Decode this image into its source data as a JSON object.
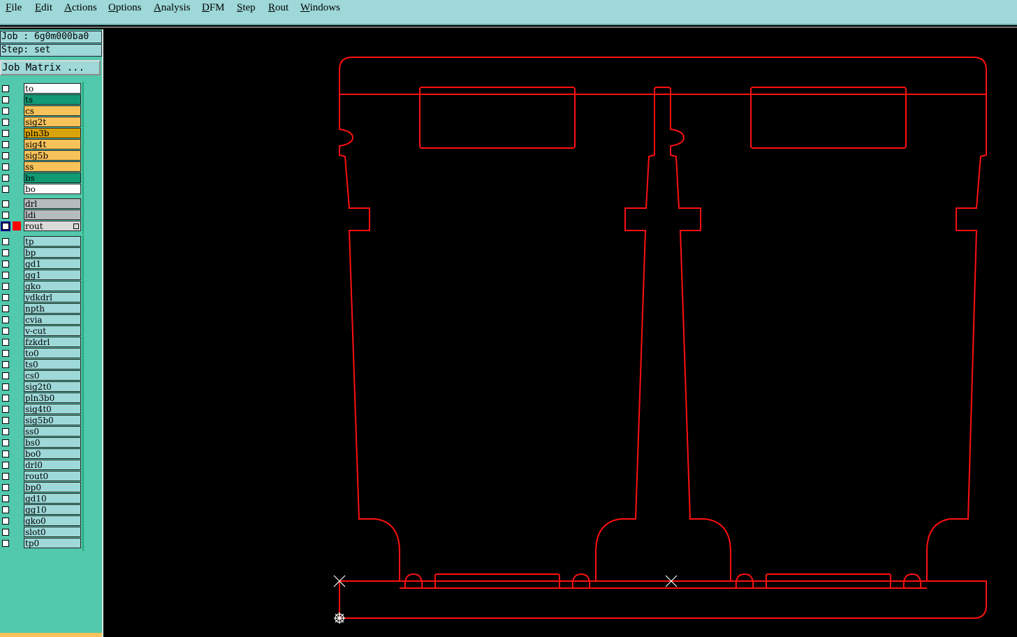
{
  "menu": [
    {
      "label": "File",
      "underline": "F",
      "rest": "ile"
    },
    {
      "label": "Edit",
      "underline": "E",
      "rest": "dit"
    },
    {
      "label": "Actions",
      "underline": "A",
      "rest": "ctions"
    },
    {
      "label": "Options",
      "underline": "O",
      "rest": "ptions"
    },
    {
      "label": "Analysis",
      "underline": "A",
      "rest": "nalysis"
    },
    {
      "label": "DFM",
      "underline": "D",
      "rest": "FM"
    },
    {
      "label": "Step",
      "underline": "S",
      "rest": "tep"
    },
    {
      "label": "Rout",
      "underline": "R",
      "rest": "out"
    },
    {
      "label": "Windows",
      "underline": "W",
      "rest": "indows"
    }
  ],
  "job_label": "Job : 6g0m000ba0",
  "step_label": "Step: set",
  "job_matrix_button": "Job Matrix ...",
  "colors": {
    "white": "#ffffff",
    "green": "#119a74",
    "orange": "#f7c25a",
    "dark_orange": "#d8a20a",
    "gray": "#b6bcbc",
    "light": "#dadada",
    "cyan": "#9ed8d8",
    "route": "#ff0000"
  },
  "groups": [
    {
      "layers": [
        {
          "name": "to",
          "color": "white"
        },
        {
          "name": "ts",
          "color": "green"
        },
        {
          "name": "cs",
          "color": "orange"
        },
        {
          "name": "sig2t",
          "color": "orange"
        },
        {
          "name": "pln3b",
          "color": "dark_orange"
        },
        {
          "name": "sig4t",
          "color": "orange"
        },
        {
          "name": "sig5b",
          "color": "orange"
        },
        {
          "name": "ss",
          "color": "orange"
        },
        {
          "name": "bs",
          "color": "green"
        },
        {
          "name": "bo",
          "color": "white"
        }
      ]
    },
    {
      "layers": [
        {
          "name": "drl",
          "color": "gray"
        },
        {
          "name": "ldi",
          "color": "gray"
        },
        {
          "name": "rout",
          "color": "light",
          "active": true
        }
      ]
    },
    {
      "layers": [
        {
          "name": "tp",
          "color": "cyan"
        },
        {
          "name": "bp",
          "color": "cyan"
        },
        {
          "name": "gd1",
          "color": "cyan"
        },
        {
          "name": "gg1",
          "color": "cyan"
        },
        {
          "name": "gko",
          "color": "cyan"
        },
        {
          "name": "ydkdrl",
          "color": "cyan"
        },
        {
          "name": "npth",
          "color": "cyan"
        },
        {
          "name": "cvia",
          "color": "cyan"
        },
        {
          "name": "v-cut",
          "color": "cyan"
        },
        {
          "name": "fzkdrl",
          "color": "cyan"
        },
        {
          "name": "to0",
          "color": "cyan"
        },
        {
          "name": "ts0",
          "color": "cyan"
        },
        {
          "name": "cs0",
          "color": "cyan"
        },
        {
          "name": "sig2t0",
          "color": "cyan"
        },
        {
          "name": "pln3b0",
          "color": "cyan"
        },
        {
          "name": "sig4t0",
          "color": "cyan"
        },
        {
          "name": "sig5b0",
          "color": "cyan"
        },
        {
          "name": "ss0",
          "color": "cyan"
        },
        {
          "name": "bs0",
          "color": "cyan"
        },
        {
          "name": "bo0",
          "color": "cyan"
        },
        {
          "name": "drl0",
          "color": "cyan"
        },
        {
          "name": "rout0",
          "color": "cyan"
        },
        {
          "name": "bp0",
          "color": "cyan"
        },
        {
          "name": "gd10",
          "color": "cyan"
        },
        {
          "name": "gg10",
          "color": "cyan"
        },
        {
          "name": "gko0",
          "color": "cyan"
        },
        {
          "name": "slot0",
          "color": "cyan"
        },
        {
          "name": "tp0",
          "color": "cyan"
        }
      ]
    }
  ]
}
